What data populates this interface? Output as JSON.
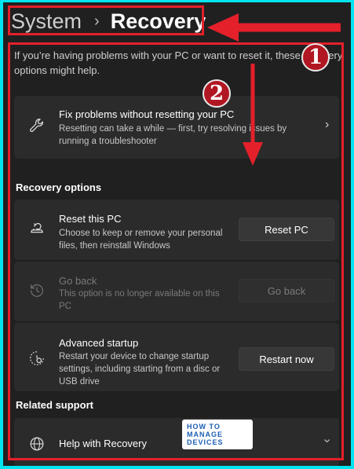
{
  "breadcrumb": {
    "parent": "System",
    "separator": "›",
    "current": "Recovery"
  },
  "intro": "If you’re having problems with your PC or want to reset it, these recovery options might help.",
  "markers": [
    "1",
    "2"
  ],
  "fix_card": {
    "title": "Fix problems without resetting your PC",
    "desc": "Resetting can take a while — first, try resolving issues by running a troubleshooter",
    "icon": "wrench-icon"
  },
  "recovery_options": {
    "heading": "Recovery options",
    "items": [
      {
        "title": "Reset this PC",
        "desc": "Choose to keep or remove your personal files, then reinstall Windows",
        "button": "Reset PC",
        "icon": "reset-pc-icon",
        "enabled": true
      },
      {
        "title": "Go back",
        "desc": "This option is no longer available on this PC",
        "button": "Go back",
        "icon": "history-icon",
        "enabled": false
      },
      {
        "title": "Advanced startup",
        "desc": "Restart your device to change startup settings, including starting from a disc or USB drive",
        "button": "Restart now",
        "icon": "advanced-startup-icon",
        "enabled": true
      }
    ]
  },
  "related_support": {
    "heading": "Related support",
    "items": [
      {
        "title": "Help with Recovery",
        "icon": "globe-icon"
      }
    ]
  },
  "watermark": {
    "line1": "HOW TO",
    "line2": "MANAGE DEVICES"
  },
  "colors": {
    "background": "#202020",
    "card": "#2b2b2b",
    "annotation": "#e4202a",
    "border": "#00e5ef"
  }
}
